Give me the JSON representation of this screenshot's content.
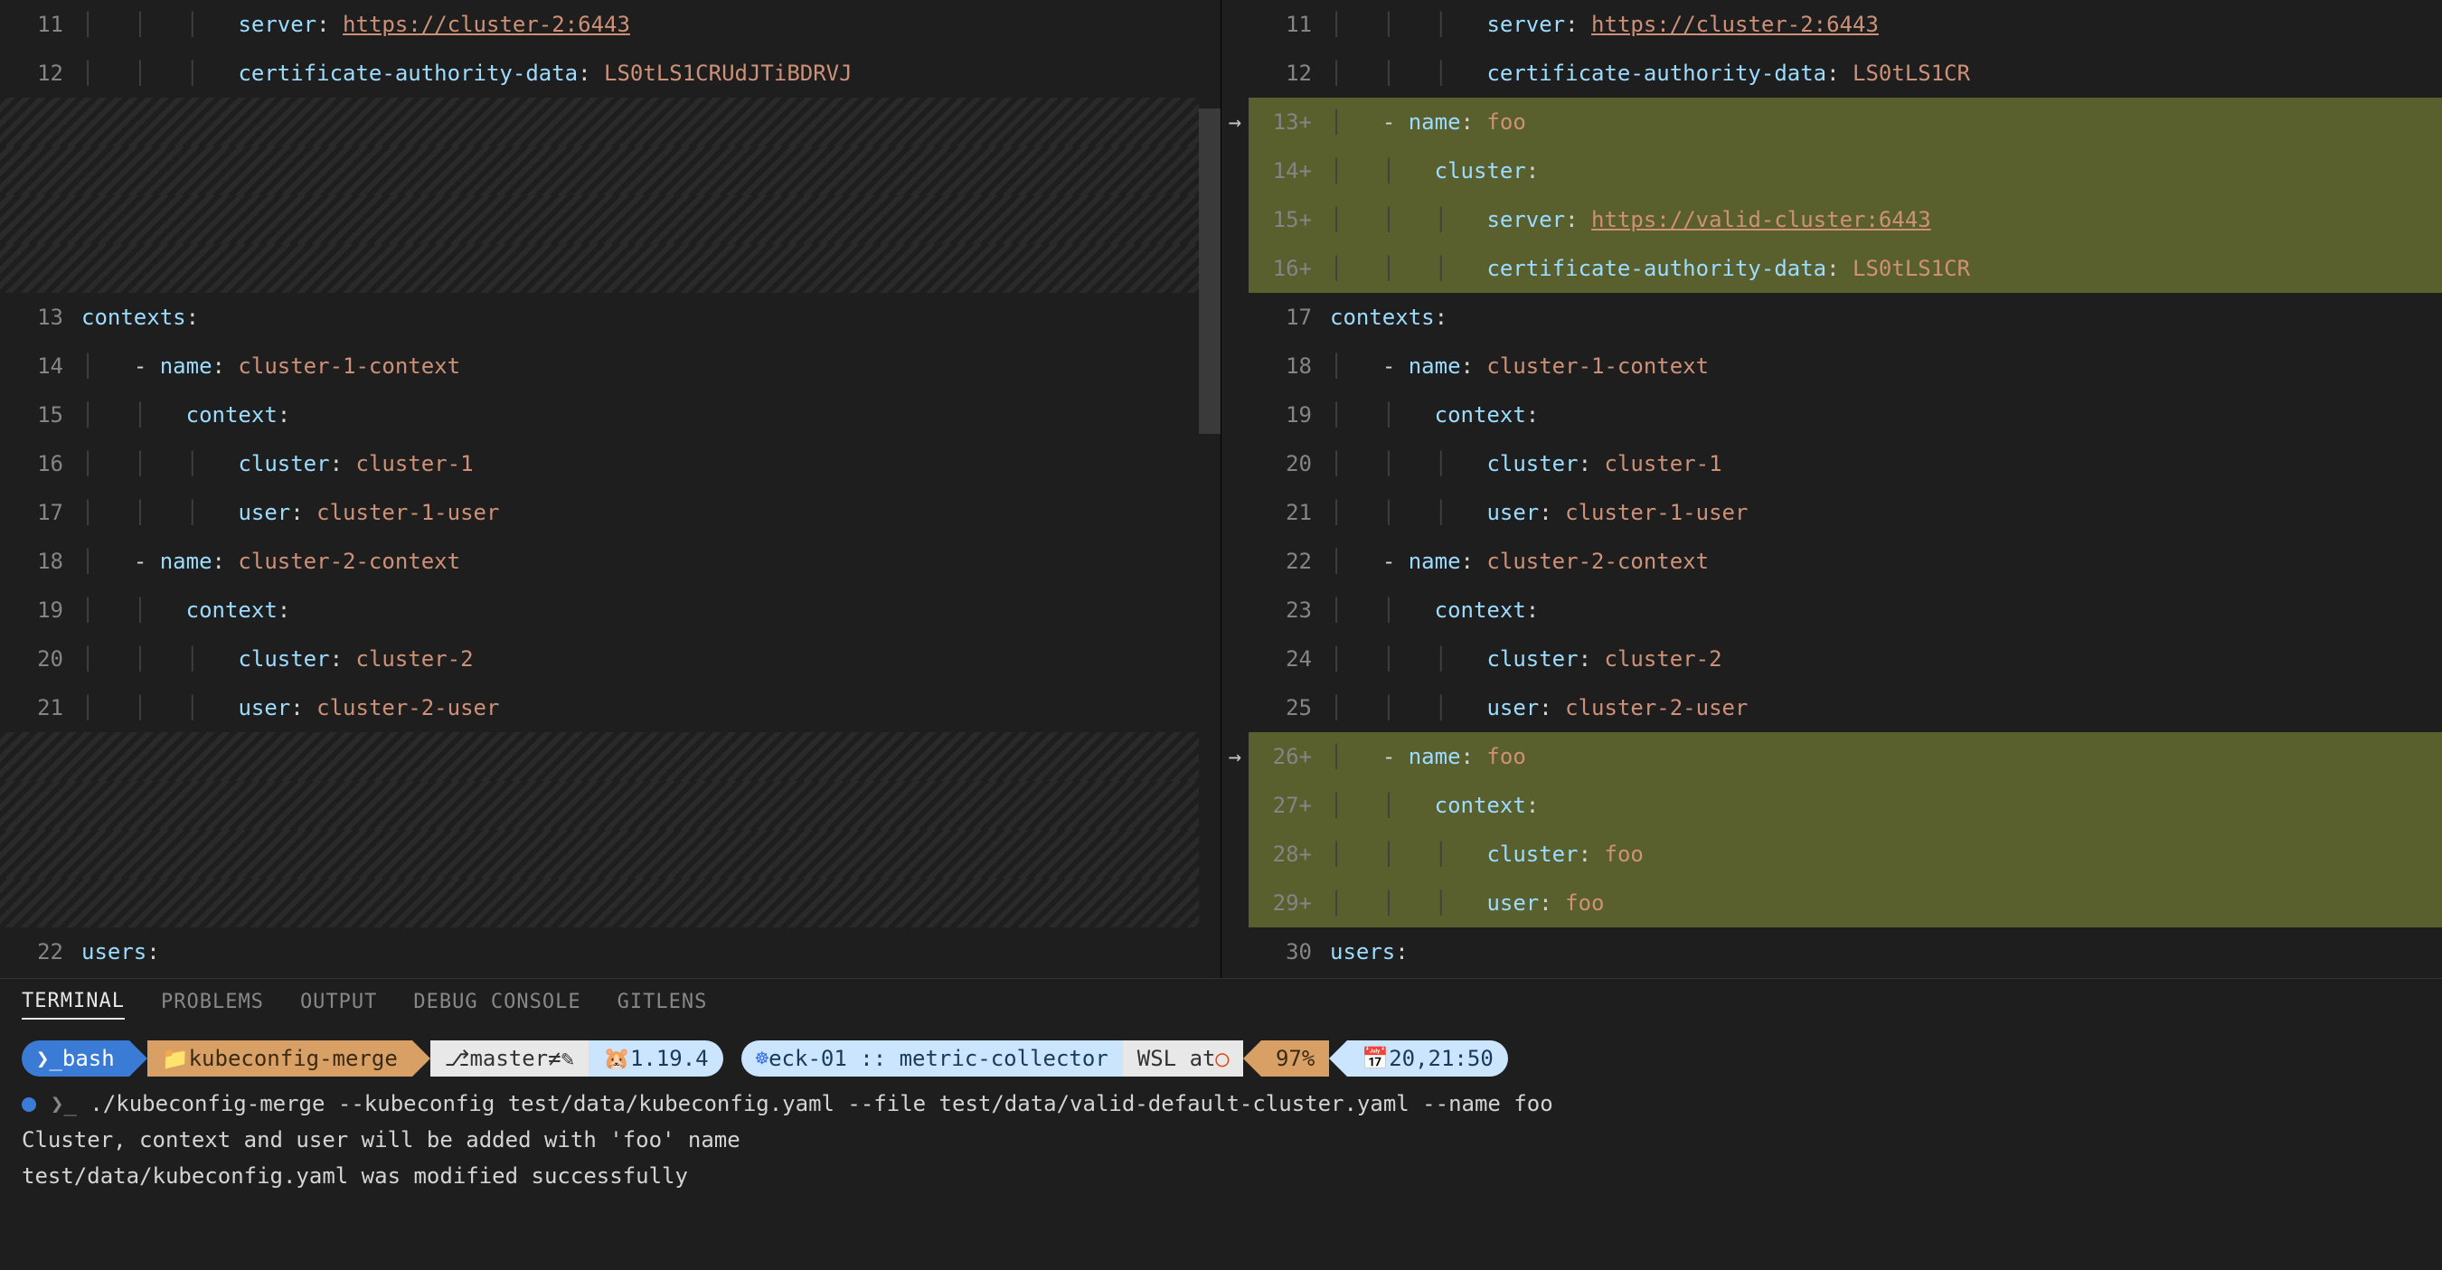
{
  "left": {
    "lines": [
      {
        "n": "11",
        "type": "code",
        "indent": 3,
        "tokens": [
          {
            "t": "k-key",
            "v": "server"
          },
          {
            "t": "k-punct",
            "v": ": "
          },
          {
            "t": "k-url",
            "v": "https://cluster-2:6443"
          }
        ]
      },
      {
        "n": "12",
        "type": "code",
        "indent": 3,
        "tokens": [
          {
            "t": "k-key",
            "v": "certificate-authority-data"
          },
          {
            "t": "k-punct",
            "v": ": "
          },
          {
            "t": "k-str",
            "v": "LS0tLS1CRUdJTiBDRVJ"
          }
        ]
      },
      {
        "n": "",
        "type": "hatched"
      },
      {
        "n": "",
        "type": "hatched"
      },
      {
        "n": "",
        "type": "hatched"
      },
      {
        "n": "",
        "type": "hatched"
      },
      {
        "n": "13",
        "type": "code",
        "indent": 0,
        "tokens": [
          {
            "t": "k-key",
            "v": "contexts"
          },
          {
            "t": "k-punct",
            "v": ":"
          }
        ]
      },
      {
        "n": "14",
        "type": "code",
        "indent": 1,
        "tokens": [
          {
            "t": "k-dash",
            "v": "- "
          },
          {
            "t": "k-key",
            "v": "name"
          },
          {
            "t": "k-punct",
            "v": ": "
          },
          {
            "t": "k-str",
            "v": "cluster-1-context"
          }
        ]
      },
      {
        "n": "15",
        "type": "code",
        "indent": 2,
        "tokens": [
          {
            "t": "k-key",
            "v": "context"
          },
          {
            "t": "k-punct",
            "v": ":"
          }
        ]
      },
      {
        "n": "16",
        "type": "code",
        "indent": 3,
        "tokens": [
          {
            "t": "k-key",
            "v": "cluster"
          },
          {
            "t": "k-punct",
            "v": ": "
          },
          {
            "t": "k-str",
            "v": "cluster-1"
          }
        ]
      },
      {
        "n": "17",
        "type": "code",
        "indent": 3,
        "tokens": [
          {
            "t": "k-key",
            "v": "user"
          },
          {
            "t": "k-punct",
            "v": ": "
          },
          {
            "t": "k-str",
            "v": "cluster-1-user"
          }
        ]
      },
      {
        "n": "18",
        "type": "code",
        "indent": 1,
        "tokens": [
          {
            "t": "k-dash",
            "v": "- "
          },
          {
            "t": "k-key",
            "v": "name"
          },
          {
            "t": "k-punct",
            "v": ": "
          },
          {
            "t": "k-str",
            "v": "cluster-2-context"
          }
        ]
      },
      {
        "n": "19",
        "type": "code",
        "indent": 2,
        "tokens": [
          {
            "t": "k-key",
            "v": "context"
          },
          {
            "t": "k-punct",
            "v": ":"
          }
        ]
      },
      {
        "n": "20",
        "type": "code",
        "indent": 3,
        "tokens": [
          {
            "t": "k-key",
            "v": "cluster"
          },
          {
            "t": "k-punct",
            "v": ": "
          },
          {
            "t": "k-str",
            "v": "cluster-2"
          }
        ]
      },
      {
        "n": "21",
        "type": "code",
        "indent": 3,
        "tokens": [
          {
            "t": "k-key",
            "v": "user"
          },
          {
            "t": "k-punct",
            "v": ": "
          },
          {
            "t": "k-str",
            "v": "cluster-2-user"
          }
        ]
      },
      {
        "n": "",
        "type": "hatched"
      },
      {
        "n": "",
        "type": "hatched"
      },
      {
        "n": "",
        "type": "hatched"
      },
      {
        "n": "",
        "type": "hatched"
      },
      {
        "n": "22",
        "type": "code",
        "indent": 0,
        "tokens": [
          {
            "t": "k-key",
            "v": "users"
          },
          {
            "t": "k-punct",
            "v": ":"
          }
        ]
      }
    ]
  },
  "right": {
    "lines": [
      {
        "n": "11",
        "type": "code",
        "indent": 3,
        "tokens": [
          {
            "t": "k-key",
            "v": "server"
          },
          {
            "t": "k-punct",
            "v": ": "
          },
          {
            "t": "k-url",
            "v": "https://cluster-2:6443"
          }
        ]
      },
      {
        "n": "12",
        "type": "code",
        "indent": 3,
        "tokens": [
          {
            "t": "k-key",
            "v": "certificate-authority-data"
          },
          {
            "t": "k-punct",
            "v": ": "
          },
          {
            "t": "k-str",
            "v": "LS0tLS1CR"
          }
        ]
      },
      {
        "n": "13",
        "plus": true,
        "arrow": true,
        "type": "inserted",
        "indent": 1,
        "tokens": [
          {
            "t": "k-dash",
            "v": "- "
          },
          {
            "t": "k-key",
            "v": "name"
          },
          {
            "t": "k-punct",
            "v": ": "
          },
          {
            "t": "k-str",
            "v": "foo"
          }
        ]
      },
      {
        "n": "14",
        "plus": true,
        "type": "inserted",
        "indent": 2,
        "tokens": [
          {
            "t": "k-key",
            "v": "cluster"
          },
          {
            "t": "k-punct",
            "v": ":"
          }
        ]
      },
      {
        "n": "15",
        "plus": true,
        "type": "inserted",
        "indent": 3,
        "tokens": [
          {
            "t": "k-key",
            "v": "server"
          },
          {
            "t": "k-punct",
            "v": ": "
          },
          {
            "t": "k-url",
            "v": "https://valid-cluster:6443"
          }
        ]
      },
      {
        "n": "16",
        "plus": true,
        "type": "inserted",
        "indent": 3,
        "tokens": [
          {
            "t": "k-key",
            "v": "certificate-authority-data"
          },
          {
            "t": "k-punct",
            "v": ": "
          },
          {
            "t": "k-str",
            "v": "LS0tLS1CR"
          }
        ]
      },
      {
        "n": "17",
        "type": "code",
        "indent": 0,
        "tokens": [
          {
            "t": "k-key",
            "v": "contexts"
          },
          {
            "t": "k-punct",
            "v": ":"
          }
        ]
      },
      {
        "n": "18",
        "type": "code",
        "indent": 1,
        "tokens": [
          {
            "t": "k-dash",
            "v": "- "
          },
          {
            "t": "k-key",
            "v": "name"
          },
          {
            "t": "k-punct",
            "v": ": "
          },
          {
            "t": "k-str",
            "v": "cluster-1-context"
          }
        ]
      },
      {
        "n": "19",
        "type": "code",
        "indent": 2,
        "tokens": [
          {
            "t": "k-key",
            "v": "context"
          },
          {
            "t": "k-punct",
            "v": ":"
          }
        ]
      },
      {
        "n": "20",
        "type": "code",
        "indent": 3,
        "tokens": [
          {
            "t": "k-key",
            "v": "cluster"
          },
          {
            "t": "k-punct",
            "v": ": "
          },
          {
            "t": "k-str",
            "v": "cluster-1"
          }
        ]
      },
      {
        "n": "21",
        "type": "code",
        "indent": 3,
        "tokens": [
          {
            "t": "k-key",
            "v": "user"
          },
          {
            "t": "k-punct",
            "v": ": "
          },
          {
            "t": "k-str",
            "v": "cluster-1-user"
          }
        ]
      },
      {
        "n": "22",
        "type": "code",
        "indent": 1,
        "tokens": [
          {
            "t": "k-dash",
            "v": "- "
          },
          {
            "t": "k-key",
            "v": "name"
          },
          {
            "t": "k-punct",
            "v": ": "
          },
          {
            "t": "k-str",
            "v": "cluster-2-context"
          }
        ]
      },
      {
        "n": "23",
        "type": "code",
        "indent": 2,
        "tokens": [
          {
            "t": "k-key",
            "v": "context"
          },
          {
            "t": "k-punct",
            "v": ":"
          }
        ]
      },
      {
        "n": "24",
        "type": "code",
        "indent": 3,
        "tokens": [
          {
            "t": "k-key",
            "v": "cluster"
          },
          {
            "t": "k-punct",
            "v": ": "
          },
          {
            "t": "k-str",
            "v": "cluster-2"
          }
        ]
      },
      {
        "n": "25",
        "type": "code",
        "indent": 3,
        "tokens": [
          {
            "t": "k-key",
            "v": "user"
          },
          {
            "t": "k-punct",
            "v": ": "
          },
          {
            "t": "k-str",
            "v": "cluster-2-user"
          }
        ]
      },
      {
        "n": "26",
        "plus": true,
        "arrow": true,
        "type": "inserted",
        "indent": 1,
        "tokens": [
          {
            "t": "k-dash",
            "v": "- "
          },
          {
            "t": "k-key",
            "v": "name"
          },
          {
            "t": "k-punct",
            "v": ": "
          },
          {
            "t": "k-str",
            "v": "foo"
          }
        ]
      },
      {
        "n": "27",
        "plus": true,
        "type": "inserted",
        "indent": 2,
        "tokens": [
          {
            "t": "k-key",
            "v": "context"
          },
          {
            "t": "k-punct",
            "v": ":"
          }
        ]
      },
      {
        "n": "28",
        "plus": true,
        "type": "inserted",
        "indent": 3,
        "tokens": [
          {
            "t": "k-key",
            "v": "cluster"
          },
          {
            "t": "k-punct",
            "v": ": "
          },
          {
            "t": "k-str",
            "v": "foo"
          }
        ]
      },
      {
        "n": "29",
        "plus": true,
        "type": "inserted",
        "indent": 3,
        "tokens": [
          {
            "t": "k-key",
            "v": "user"
          },
          {
            "t": "k-punct",
            "v": ": "
          },
          {
            "t": "k-str",
            "v": "foo"
          }
        ]
      },
      {
        "n": "30",
        "type": "code",
        "indent": 0,
        "tokens": [
          {
            "t": "k-key",
            "v": "users"
          },
          {
            "t": "k-punct",
            "v": ":"
          }
        ]
      }
    ]
  },
  "panel": {
    "tabs": [
      "TERMINAL",
      "PROBLEMS",
      "OUTPUT",
      "DEBUG CONSOLE",
      "GITLENS"
    ],
    "active": 0
  },
  "powerline": {
    "shell": "bash",
    "dir": "kubeconfig-merge",
    "branch": "master",
    "branch_dirty": "≠",
    "go_version": "1.19.4",
    "kube_ctx": "eck-01 :: metric-collector",
    "wsl": "WSL at",
    "battery": "97%",
    "time": "20,21:50"
  },
  "terminal": {
    "cmd": "./kubeconfig-merge --kubeconfig test/data/kubeconfig.yaml --file test/data/valid-default-cluster.yaml --name foo",
    "out1": "Cluster, context and user will be added with 'foo' name",
    "out2": "test/data/kubeconfig.yaml was modified successfully"
  }
}
